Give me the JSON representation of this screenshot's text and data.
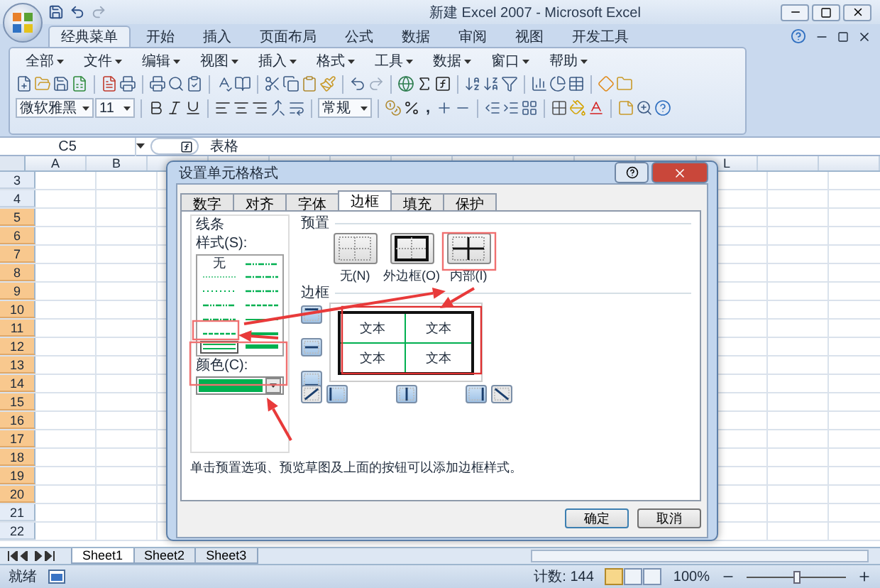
{
  "window": {
    "title": "新建 Excel 2007 - Microsoft Excel"
  },
  "ribbon_tabs": [
    {
      "label": "经典菜单",
      "selected": true
    },
    {
      "label": "开始",
      "selected": false
    },
    {
      "label": "插入",
      "selected": false
    },
    {
      "label": "页面布局",
      "selected": false
    },
    {
      "label": "公式",
      "selected": false
    },
    {
      "label": "数据",
      "selected": false
    },
    {
      "label": "审阅",
      "selected": false
    },
    {
      "label": "视图",
      "selected": false
    },
    {
      "label": "开发工具",
      "selected": false
    }
  ],
  "menus": [
    "全部",
    "文件",
    "编辑",
    "视图",
    "插入",
    "格式",
    "工具",
    "数据",
    "窗口",
    "帮助"
  ],
  "format_bar": {
    "font": "微软雅黑",
    "size": "11",
    "number_format": "常规",
    "comma": ","
  },
  "formula_bar": {
    "name_box": "C5",
    "content": "表格"
  },
  "sheet": {
    "columns": [
      {
        "label": "A"
      },
      {
        "label": "B"
      },
      {
        "label": "L"
      }
    ],
    "rows": [
      {
        "label": "3",
        "selected": false
      },
      {
        "label": "4",
        "selected": false
      },
      {
        "label": "5",
        "selected": true
      },
      {
        "label": "6",
        "selected": true
      },
      {
        "label": "7",
        "selected": true
      },
      {
        "label": "8",
        "selected": true
      },
      {
        "label": "9",
        "selected": true
      },
      {
        "label": "10",
        "selected": true
      },
      {
        "label": "11",
        "selected": true
      },
      {
        "label": "12",
        "selected": true
      },
      {
        "label": "13",
        "selected": true
      },
      {
        "label": "14",
        "selected": true
      },
      {
        "label": "15",
        "selected": true
      },
      {
        "label": "16",
        "selected": true
      },
      {
        "label": "17",
        "selected": true
      },
      {
        "label": "18",
        "selected": true
      },
      {
        "label": "19",
        "selected": true
      },
      {
        "label": "20",
        "selected": true
      },
      {
        "label": "21",
        "selected": false
      },
      {
        "label": "22",
        "selected": false
      }
    ],
    "tabs": [
      {
        "label": "Sheet1",
        "selected": true
      },
      {
        "label": "Sheet2",
        "selected": false
      },
      {
        "label": "Sheet3",
        "selected": false
      }
    ]
  },
  "status_bar": {
    "state": "就绪",
    "count": "计数: 144",
    "zoom": "100%",
    "zoom_level": {
      "level": 0.5
    }
  },
  "dialog": {
    "title": "设置单元格格式",
    "tabs": [
      {
        "label": "数字",
        "selected": false
      },
      {
        "label": "对齐",
        "selected": false
      },
      {
        "label": "字体",
        "selected": false
      },
      {
        "label": "边框",
        "selected": true
      },
      {
        "label": "填充",
        "selected": false
      },
      {
        "label": "保护",
        "selected": false
      }
    ],
    "line": {
      "label": "线条",
      "style_label": "样式(S):",
      "color_label": "颜色(C):",
      "color": "#00b050",
      "styles": [
        {
          "kind": "none",
          "label": "无",
          "selected": false
        },
        {
          "kind": "hair",
          "selected": false
        },
        {
          "kind": "dotted",
          "selected": false
        },
        {
          "kind": "dashdotdot",
          "selected": false
        },
        {
          "kind": "dashdot",
          "selected": false
        },
        {
          "kind": "dashed",
          "selected": false
        },
        {
          "kind": "double",
          "selected": true
        },
        {
          "kind": "dashdotdot",
          "selected": false
        },
        {
          "kind": "dashdot",
          "selected": false
        },
        {
          "kind": "dashdot",
          "selected": false
        },
        {
          "kind": "dashed",
          "selected": false
        },
        {
          "kind": "thin",
          "selected": false
        },
        {
          "kind": "medium",
          "selected": false
        },
        {
          "kind": "thick",
          "selected": false
        }
      ]
    },
    "presets": {
      "label": "预置",
      "buttons": [
        {
          "kind": "none",
          "label": "无(N)"
        },
        {
          "kind": "outline",
          "label": "外边框(O)"
        },
        {
          "kind": "inside",
          "label": "内部(I)"
        }
      ]
    },
    "border": {
      "label": "边框",
      "outline": true,
      "inside": true,
      "cells": [
        "文本",
        "文本",
        "文本",
        "文本"
      ]
    },
    "hint": "单击预置选项、预览草图及上面的按钮可以添加边框样式。",
    "buttons": [
      "确定",
      "取消"
    ]
  }
}
